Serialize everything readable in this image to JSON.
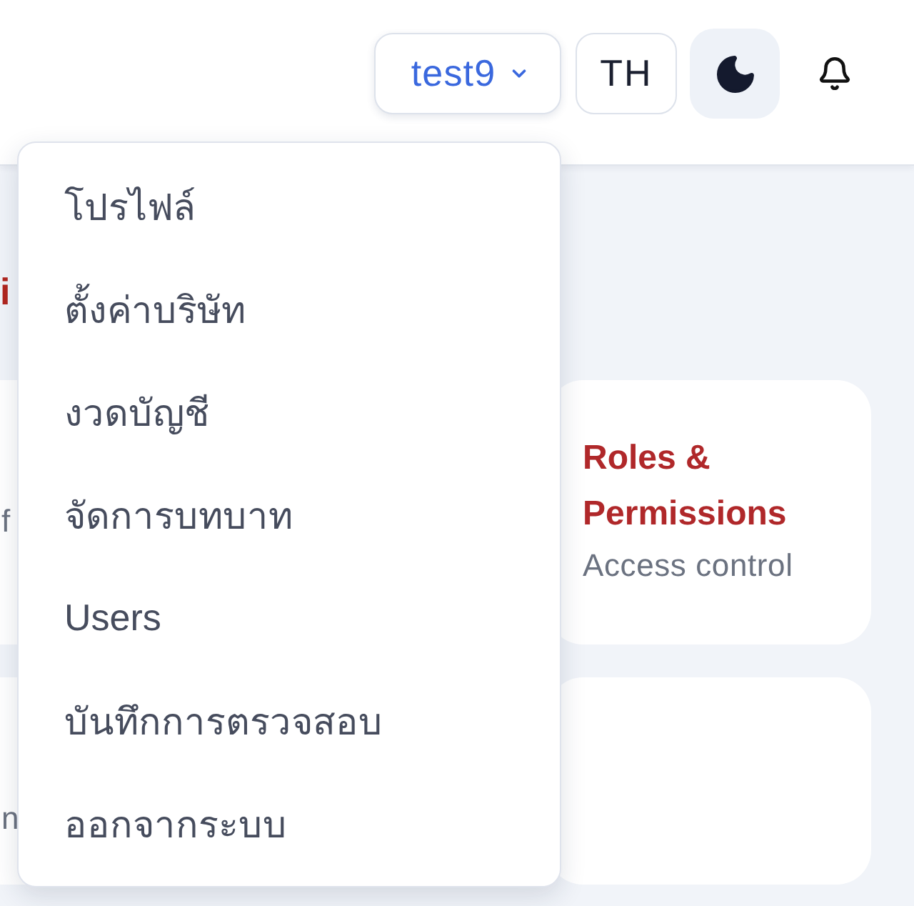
{
  "header": {
    "user_menu": {
      "label": "test9",
      "expanded": true,
      "items": [
        {
          "label": "โปรไฟล์"
        },
        {
          "label": "ตั้งค่าบริษัท"
        },
        {
          "label": "งวดบัญชี"
        },
        {
          "label": "จัดการบทบาท"
        },
        {
          "label": "Users"
        },
        {
          "label": "บันทึกการตรวจสอบ"
        },
        {
          "label": "ออกจากระบบ"
        }
      ]
    },
    "language_button": {
      "label": "TH"
    }
  },
  "page": {
    "heading": "i",
    "cards": [
      {
        "kind": "covered",
        "description": "f"
      },
      {
        "kind": "open",
        "title": "Roles & Permissions",
        "description": "Access control"
      },
      {
        "kind": "covered",
        "description": "n"
      },
      {
        "kind": "open"
      }
    ]
  }
}
